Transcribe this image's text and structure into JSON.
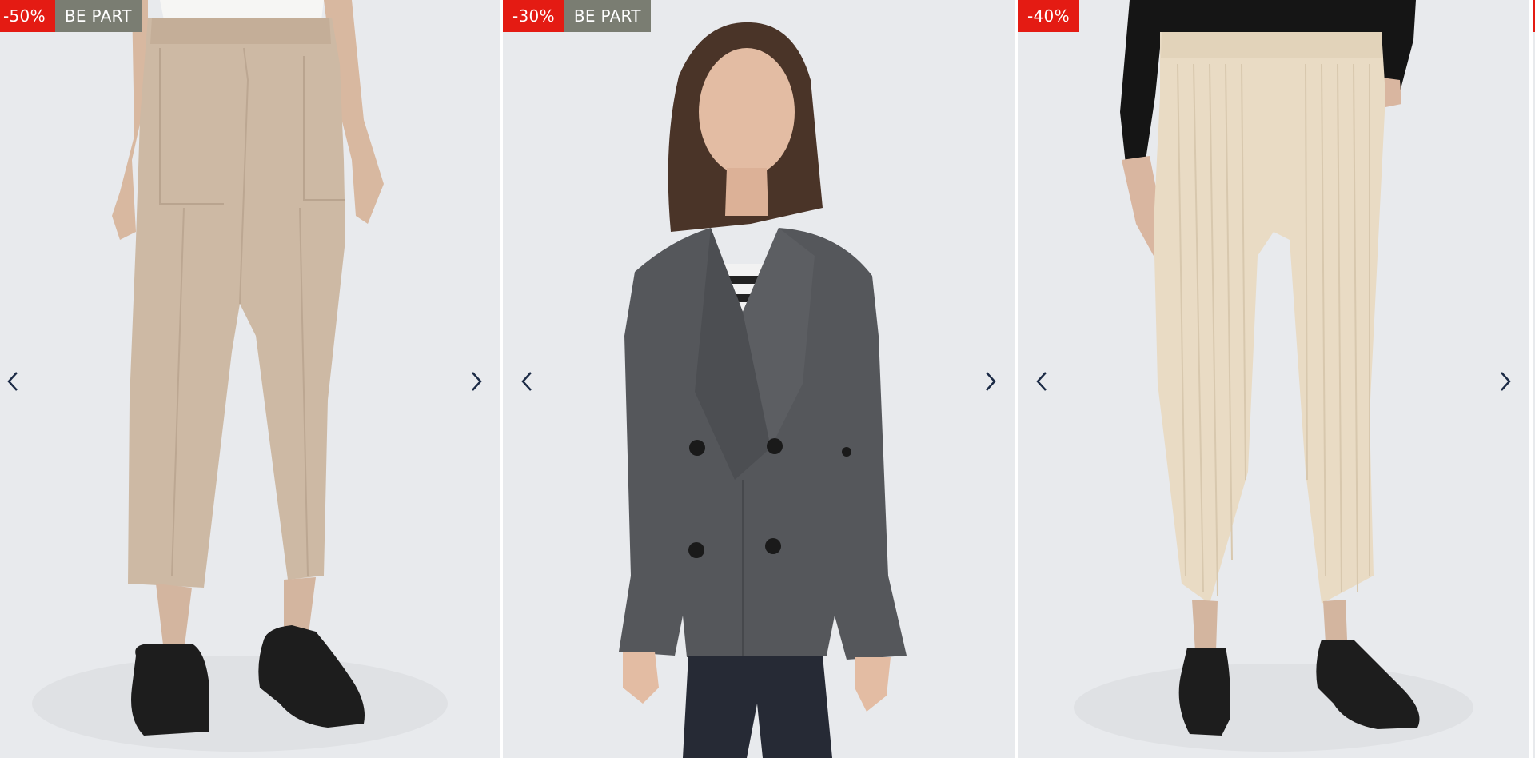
{
  "colors": {
    "background": "#e8eaed",
    "discount_badge": "#e41b13",
    "bepart_badge": "#7a7d72",
    "arrow": "#1b2a45"
  },
  "products": [
    {
      "discount": "-50%",
      "tag": "BE PART",
      "image_icon": "beige-trousers-image",
      "prev_icon": "chevron-left-icon",
      "next_icon": "chevron-right-icon"
    },
    {
      "discount": "-30%",
      "tag": "BE PART",
      "image_icon": "grey-wool-coat-image",
      "prev_icon": "chevron-left-icon",
      "next_icon": "chevron-right-icon"
    },
    {
      "discount": "-40%",
      "image_icon": "cream-corduroy-trousers-image",
      "prev_icon": "chevron-left-icon",
      "next_icon": "chevron-right-icon"
    }
  ]
}
